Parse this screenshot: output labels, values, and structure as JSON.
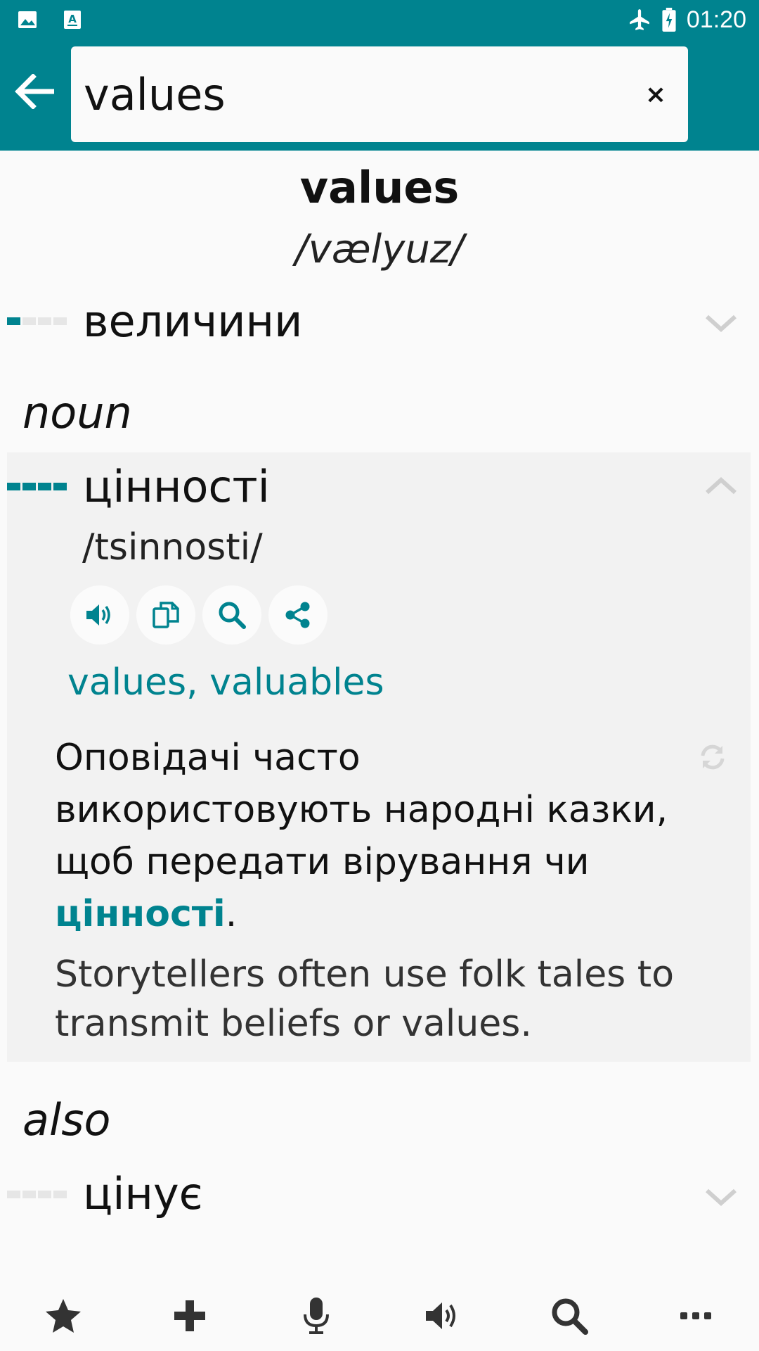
{
  "status_bar": {
    "time": "01:20",
    "left_icons": [
      "image-icon",
      "text-notification-icon"
    ],
    "right_icons": [
      "airplane-icon",
      "battery-charging-icon"
    ]
  },
  "toolbar": {
    "back_icon": "arrow-left-icon",
    "search": {
      "value": "values",
      "placeholder": ""
    },
    "clear_label": "×"
  },
  "headword": {
    "word": "values",
    "pronunciation": "/vælyuz/"
  },
  "entries": [
    {
      "translation": "величини",
      "frequency": 1,
      "expanded": false
    }
  ],
  "sections": {
    "noun": {
      "label": "noun",
      "entry": {
        "translation": "цінності",
        "frequency": 4,
        "transliteration": "/tsinnosti/",
        "actions": [
          "speaker-icon",
          "copy-icon",
          "search-icon",
          "share-icon"
        ],
        "synonyms": "values, valuables",
        "example_uk_prefix": "Оповідачі часто використовують народні казки, щоб передати вірування чи ",
        "example_uk_highlight": "цінності",
        "example_uk_suffix": ".",
        "example_en": "Storytellers often use folk tales to transmit beliefs or values."
      }
    },
    "also": {
      "label": "also",
      "entry": {
        "translation": "цінує",
        "frequency": 0
      }
    }
  },
  "bottom_bar": [
    "star-icon",
    "plus-icon",
    "microphone-icon",
    "speaker-icon",
    "search-icon",
    "more-icon"
  ],
  "colors": {
    "accent": "#00838f",
    "background": "#fafafa",
    "card": "#f2f2f2"
  }
}
